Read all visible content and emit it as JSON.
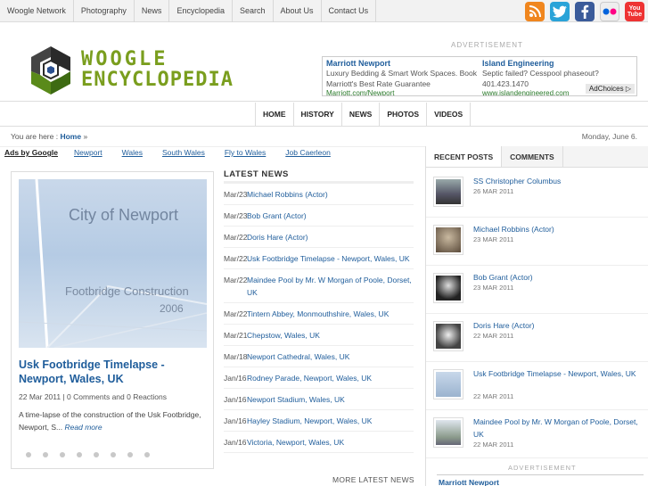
{
  "topnav": [
    "Woogle Network",
    "Photography",
    "News",
    "Encyclopedia",
    "Search",
    "About Us",
    "Contact Us"
  ],
  "social": [
    "rss-icon",
    "twitter-icon",
    "facebook-icon",
    "flickr-icon",
    "youtube-icon"
  ],
  "youtube_text": "You Tube",
  "logo": {
    "line1": "WOOGLE",
    "line2": "ENCYCLOPEDIA"
  },
  "ad_label": "ADVERTISEMENT",
  "top_ads": [
    {
      "title": "Marriott Newport",
      "desc1": "Luxury Bedding & Smart Work Spaces. Book",
      "desc2": "Marriott's Best Rate Guarantee",
      "url": "Marriott.com/Newport"
    },
    {
      "title": "Island Engineering",
      "desc1": "Septic failed? Cesspool phaseout?",
      "desc2": "401.423.1470",
      "url": "www.islandengineered.com"
    }
  ],
  "adchoices": "AdChoices",
  "mainnav": [
    "HOME",
    "HISTORY",
    "NEWS",
    "PHOTOS",
    "VIDEOS"
  ],
  "breadcrumb": {
    "prefix": "You are here :",
    "home": "Home",
    "sep": "»"
  },
  "date": "Monday, June 6.",
  "adlinks": {
    "label": "Ads by Google",
    "links": [
      "Newport",
      "Wales",
      "South Wales",
      "Fly to Wales",
      "Job Caerleon"
    ]
  },
  "feature": {
    "image_text": [
      "City of Newport",
      "Footbridge Construction",
      "2006"
    ],
    "title": "Usk Footbridge Timelapse - Newport, Wales, UK",
    "meta": "22 Mar 2011 | 0 Comments and 0 Reactions",
    "excerpt": "A time-lapse of the construction of the Usk Footbridge, Newport, S...",
    "read_more": "Read more",
    "slides": 8
  },
  "latest": {
    "heading": "LATEST NEWS",
    "items": [
      {
        "date": "Mar/23",
        "title": "Michael Robbins (Actor)"
      },
      {
        "date": "Mar/23",
        "title": "Bob Grant (Actor)"
      },
      {
        "date": "Mar/22",
        "title": "Doris Hare (Actor)"
      },
      {
        "date": "Mar/22",
        "title": "Usk Footbridge Timelapse - Newport, Wales, UK"
      },
      {
        "date": "Mar/22",
        "title": "Maindee Pool by Mr. W Morgan of Poole, Dorset, UK"
      },
      {
        "date": "Mar/22",
        "title": "Tintern Abbey, Monmouthshire, Wales, UK"
      },
      {
        "date": "Mar/21",
        "title": "Chepstow, Wales, UK"
      },
      {
        "date": "Mar/18",
        "title": "Newport Cathedral, Wales, UK"
      },
      {
        "date": "Jan/16",
        "title": "Rodney Parade, Newport, Wales, UK"
      },
      {
        "date": "Jan/16",
        "title": "Newport Stadium, Wales, UK"
      },
      {
        "date": "Jan/16",
        "title": "Hayley Stadium, Newport, Wales, UK"
      },
      {
        "date": "Jan/16",
        "title": "Victoria, Newport, Wales, UK"
      }
    ],
    "more": "MORE LATEST NEWS"
  },
  "sidebar": {
    "tabs": [
      "RECENT POSTS",
      "COMMENTS"
    ],
    "posts": [
      {
        "title": "SS Christopher Columbus",
        "date": "26 MAR 2011"
      },
      {
        "title": "Michael Robbins (Actor)",
        "date": "23 MAR 2011"
      },
      {
        "title": "Bob Grant (Actor)",
        "date": "23 MAR 2011"
      },
      {
        "title": "Doris Hare (Actor)",
        "date": "22 MAR 2011"
      },
      {
        "title": "Usk Footbridge Timelapse - Newport, Wales, UK",
        "date": "22 MAR 2011"
      },
      {
        "title": "Maindee Pool by Mr. W Morgan of Poole, Dorset, UK",
        "date": "22 MAR 2011"
      }
    ],
    "ad_label": "ADVERTISEMENT",
    "ad_title": "Marriott Newport"
  }
}
